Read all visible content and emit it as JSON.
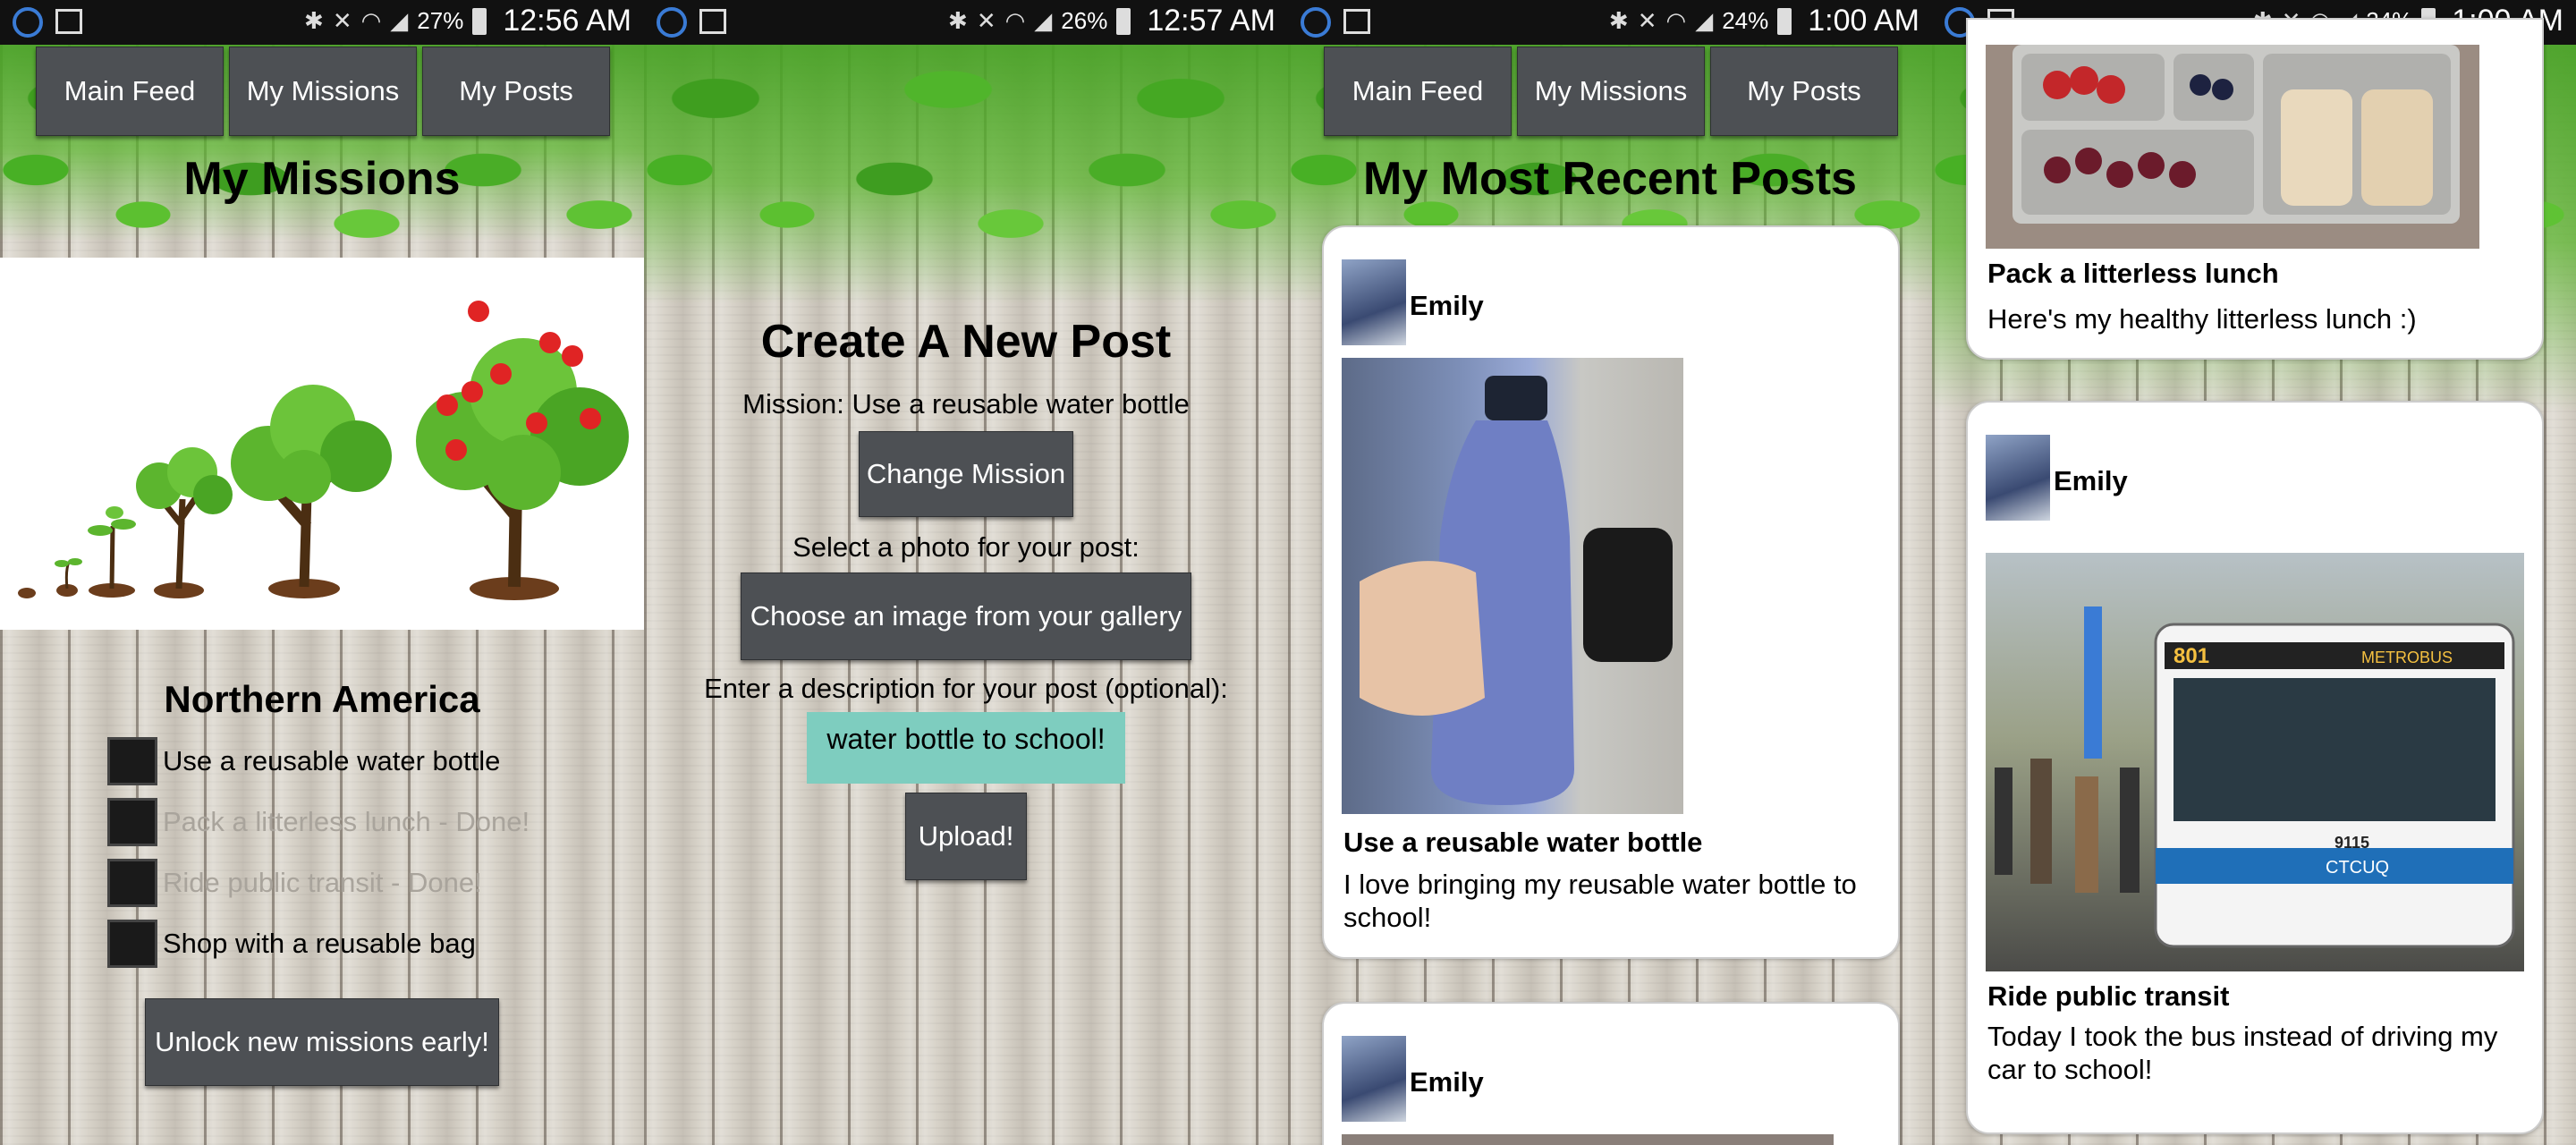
{
  "status_bars": [
    {
      "battery": "27%",
      "time": "12:56 AM"
    },
    {
      "battery": "26%",
      "time": "12:57 AM"
    },
    {
      "battery": "24%",
      "time": "1:00 AM"
    },
    {
      "battery": "24%",
      "time": "1:00 AM"
    }
  ],
  "nav": {
    "main_feed": "Main Feed",
    "my_missions": "My Missions",
    "my_posts": "My Posts"
  },
  "missions_screen": {
    "title": "My Missions",
    "region": "Northern America",
    "missions": [
      {
        "label": "Use a reusable water bottle",
        "done": false
      },
      {
        "label": "Pack a litterless lunch - Done!",
        "done": true
      },
      {
        "label": "Ride public transit - Done!",
        "done": true
      },
      {
        "label": "Shop with a reusable bag",
        "done": false
      }
    ],
    "unlock_button": "Unlock new missions early!"
  },
  "new_post_screen": {
    "title": "Create A New Post",
    "mission_line": "Mission:  Use a reusable water bottle",
    "change_mission": "Change Mission",
    "select_photo": "Select a photo for your post:",
    "choose_image": "Choose an image from your gallery",
    "enter_description": "Enter a description for your post (optional):",
    "description_value": "water bottle to school!",
    "upload": "Upload!"
  },
  "posts_screen": {
    "title": "My Most Recent Posts",
    "posts": [
      {
        "user": "Emily",
        "mission": "Use a reusable water bottle",
        "description": "I love bringing my reusable water bottle to school!"
      },
      {
        "user": "Emily"
      }
    ]
  },
  "posts_screen_scrolled": {
    "posts": [
      {
        "mission": "Pack a litterless lunch",
        "description": "Here's my healthy litterless lunch :)"
      },
      {
        "user": "Emily",
        "mission": "Ride public transit",
        "description": "Today I took the bus instead of driving my car to school!",
        "bus_route": "801",
        "bus_dest": "METROBUS",
        "bus_number": "9115",
        "bus_brand": "CTCUQ"
      }
    ]
  }
}
